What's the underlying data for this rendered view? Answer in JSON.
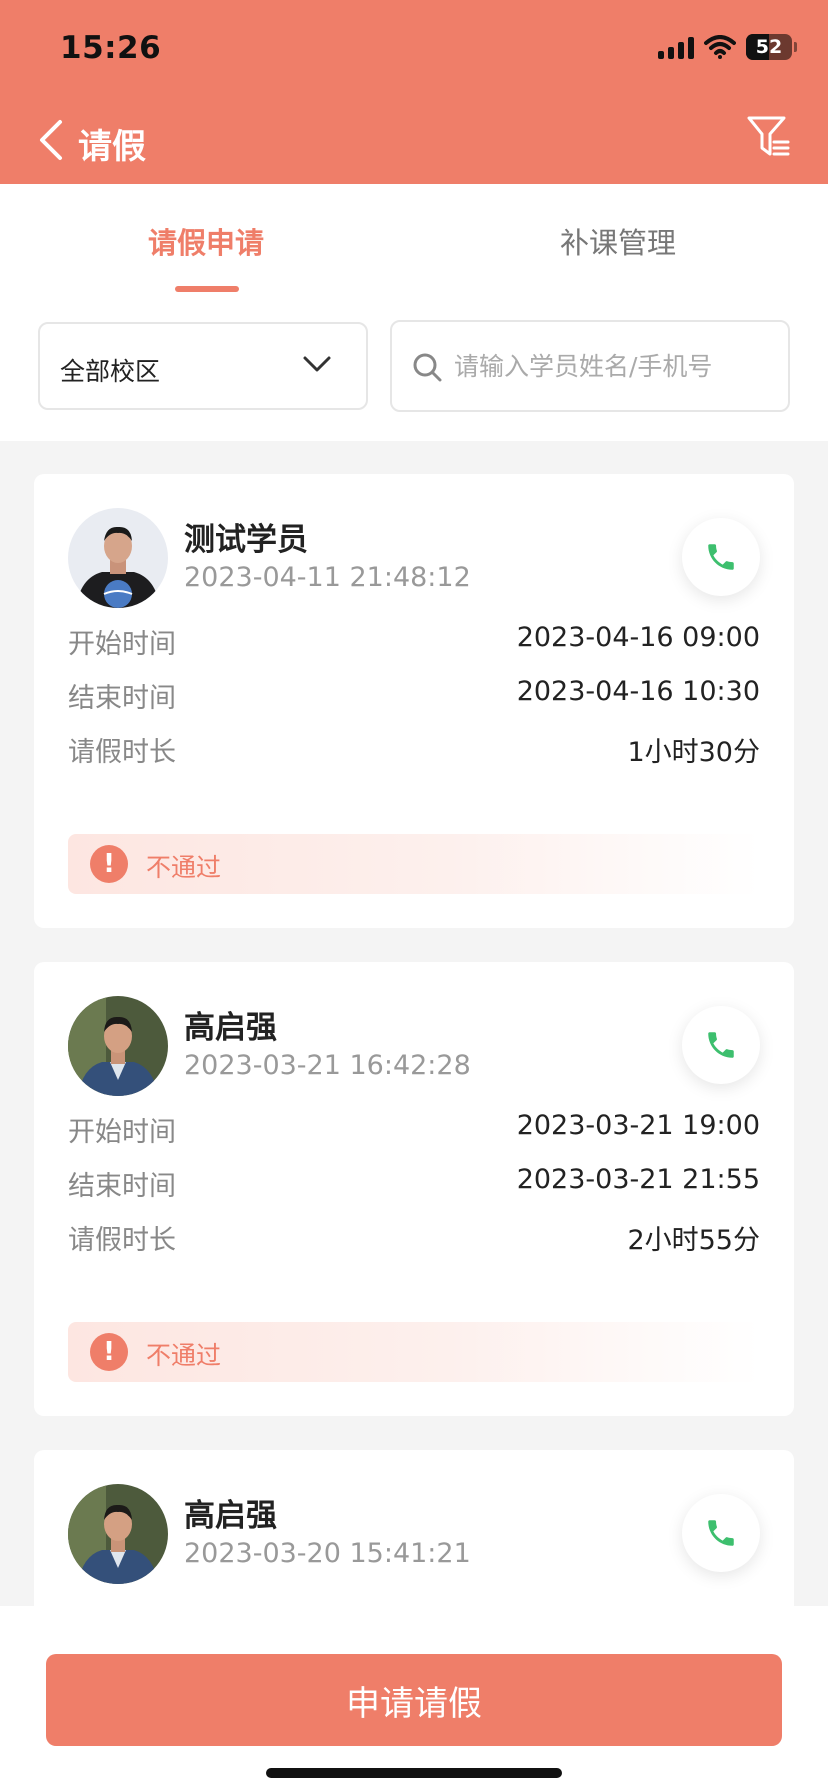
{
  "status_bar": {
    "time": "15:26",
    "battery": "52"
  },
  "nav": {
    "title": "请假",
    "back_icon": "chevron-left-icon",
    "filter_icon": "filter-list-icon"
  },
  "tabs": [
    {
      "label": "请假申请",
      "active": true
    },
    {
      "label": "补课管理",
      "active": false
    }
  ],
  "filters": {
    "campus": {
      "selected": "全部校区"
    },
    "search": {
      "placeholder": "请输入学员姓名/手机号",
      "value": ""
    }
  },
  "labels": {
    "start": "开始时间",
    "end": "结束时间",
    "duration": "请假时长"
  },
  "records": [
    {
      "name": "测试学员",
      "submitted": "2023-04-11 21:48:12",
      "start": "2023-04-16 09:00",
      "end": "2023-04-16 10:30",
      "duration": "1小时30分",
      "status": "不通过"
    },
    {
      "name": "高启强",
      "submitted": "2023-03-21 16:42:28",
      "start": "2023-03-21 19:00",
      "end": "2023-03-21 21:55",
      "duration": "2小时55分",
      "status": "不通过"
    },
    {
      "name": "高启强",
      "submitted": "2023-03-20 15:41:21"
    }
  ],
  "footer": {
    "apply_label": "申请请假"
  },
  "colors": {
    "accent": "#ef7e69",
    "call_green": "#3dbf6e",
    "page_bg": "#f4f4f4"
  }
}
